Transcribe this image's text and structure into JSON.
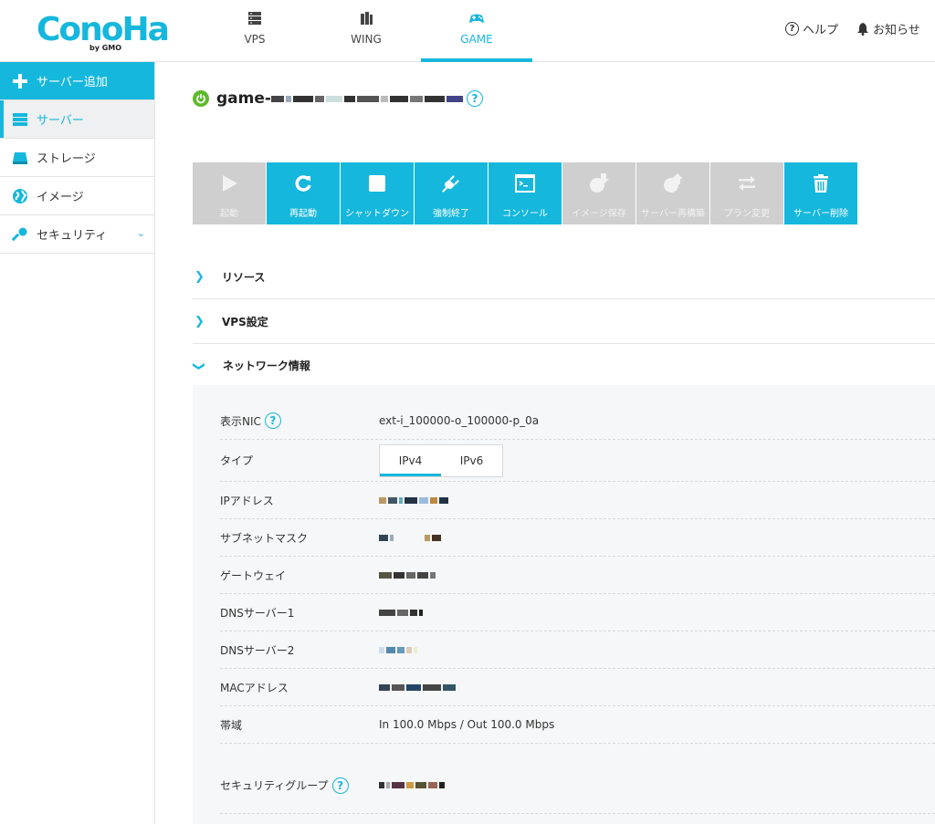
{
  "brand": {
    "logo_text": "ConoHa",
    "logo_sub": "by GMO",
    "accent": "#16b7dc",
    "power_color": "#5dba2a"
  },
  "topnav": {
    "items": [
      {
        "label": "VPS",
        "icon": "server-stack-icon"
      },
      {
        "label": "WING",
        "icon": "wing-icon"
      },
      {
        "label": "GAME",
        "icon": "gamepad-icon"
      }
    ],
    "help_label": "ヘルプ",
    "notice_label": "お知らせ"
  },
  "sidebar": {
    "items": [
      {
        "label": "サーバー追加",
        "icon": "plus-icon"
      },
      {
        "label": "サーバー",
        "icon": "server-icon"
      },
      {
        "label": "ストレージ",
        "icon": "storage-icon"
      },
      {
        "label": "イメージ",
        "icon": "globe-icon"
      },
      {
        "label": "セキュリティ",
        "icon": "key-icon"
      }
    ]
  },
  "server": {
    "title_prefix": "game-"
  },
  "actions": [
    {
      "label": "起動",
      "enabled": false
    },
    {
      "label": "再起動",
      "enabled": true
    },
    {
      "label": "シャットダウン",
      "enabled": true
    },
    {
      "label": "強制終了",
      "enabled": true
    },
    {
      "label": "コンソール",
      "enabled": true
    },
    {
      "label": "イメージ保存",
      "enabled": false
    },
    {
      "label": "サーバー再構築",
      "enabled": false
    },
    {
      "label": "プラン変更",
      "enabled": false
    },
    {
      "label": "サーバー削除",
      "enabled": true
    }
  ],
  "sections": [
    {
      "label": "リソース",
      "expanded": false
    },
    {
      "label": "VPS設定",
      "expanded": false
    },
    {
      "label": "ネットワーク情報",
      "expanded": true
    }
  ],
  "network": {
    "nic_label": "表示NIC",
    "nic_value": "ext-i_100000-o_100000-p_0a",
    "type_label": "タイプ",
    "tabs": [
      "IPv4",
      "IPv6"
    ],
    "ip_label": "IPアドレス",
    "subnet_label": "サブネットマスク",
    "gateway_label": "ゲートウェイ",
    "dns1_label": "DNSサーバー1",
    "dns2_label": "DNSサーバー2",
    "mac_label": "MACアドレス",
    "bandwidth_label": "帯域",
    "bandwidth_value": "In 100.0 Mbps / Out 100.0 Mbps",
    "secgroup_label": "セキュリティグループ"
  }
}
